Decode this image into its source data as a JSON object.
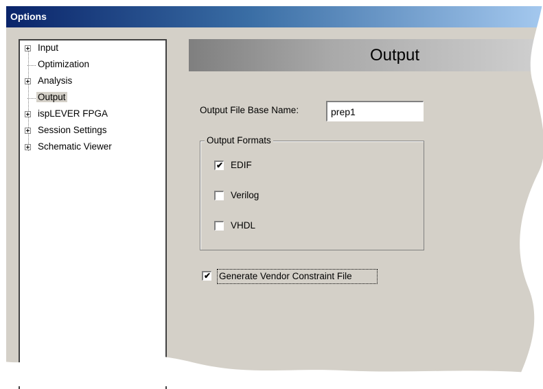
{
  "window": {
    "title": "Options"
  },
  "tree": {
    "items": [
      {
        "label": "Input",
        "expandable": true
      },
      {
        "label": "Optimization",
        "expandable": false
      },
      {
        "label": "Analysis",
        "expandable": true
      },
      {
        "label": "Output",
        "expandable": false,
        "selected": true
      },
      {
        "label": "ispLEVER FPGA",
        "expandable": true
      },
      {
        "label": "Session Settings",
        "expandable": true
      },
      {
        "label": "Schematic Viewer",
        "expandable": true
      }
    ]
  },
  "panel": {
    "header": "Output",
    "base_name_label": "Output File Base Name:",
    "base_name_value": "prep1",
    "formats_title": "Output Formats",
    "formats": [
      {
        "label": "EDIF",
        "checked": true
      },
      {
        "label": "Verilog",
        "checked": false
      },
      {
        "label": "VHDL",
        "checked": false
      }
    ],
    "vendor_constraint": {
      "label": "Generate Vendor Constraint File",
      "checked": true
    }
  },
  "colors": {
    "titlebar_start": "#0a246a",
    "titlebar_end": "#a6caf0",
    "dialog_bg": "#d4d0c8"
  },
  "icons": {
    "expand": "plus-box-icon",
    "check": "checkmark-icon"
  }
}
